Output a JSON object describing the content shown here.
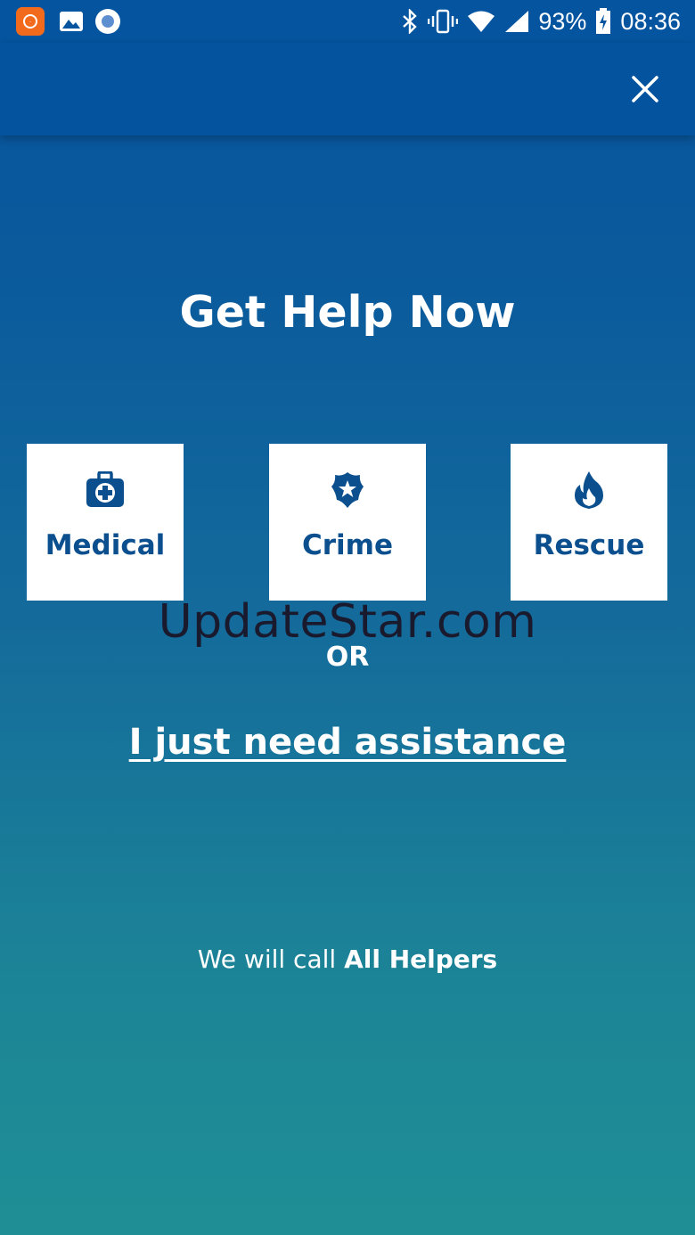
{
  "status_bar": {
    "battery": "93%",
    "time": "08:36",
    "left_icons": [
      "app-notification-icon",
      "gallery-icon",
      "record-icon"
    ],
    "right_icons": [
      "bluetooth-icon",
      "vibrate-icon",
      "wifi-icon",
      "signal-icon",
      "battery-charging-icon"
    ]
  },
  "app_bar": {
    "close_icon": "close-icon"
  },
  "main": {
    "title": "Get Help Now",
    "categories": [
      {
        "label": "Medical",
        "icon": "medical-kit-icon"
      },
      {
        "label": "Crime",
        "icon": "police-badge-icon"
      },
      {
        "label": "Rescue",
        "icon": "fire-icon"
      }
    ],
    "watermark": "UpdateStar.com",
    "or_text": "OR",
    "assist_link": "I just need assistance",
    "footer_prefix": "We will call",
    "footer_bold": "All Helpers"
  },
  "colors": {
    "accent": "#0b4f8e",
    "header": "#04539e",
    "bottom_gradient": "#1f8f95"
  }
}
